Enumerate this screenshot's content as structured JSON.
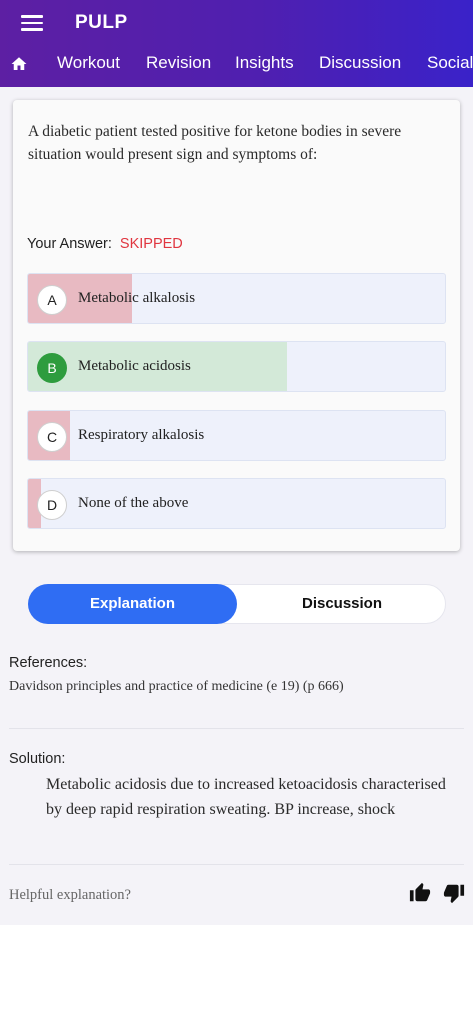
{
  "app": {
    "title": "PULP"
  },
  "nav": {
    "tabs": [
      "Workout",
      "Revision",
      "Insights",
      "Discussion",
      "Social"
    ]
  },
  "question": {
    "text": "A diabetic patient tested positive for ketone bodies in severe situation would present sign and symptoms of:",
    "your_answer_label": "Your Answer:",
    "your_answer_value": "SKIPPED"
  },
  "options": [
    {
      "letter": "A",
      "text": "Metabolic alkalosis",
      "response_share_pct": 25,
      "correct": false
    },
    {
      "letter": "B",
      "text": "Metabolic acidosis",
      "response_share_pct": 62,
      "correct": true
    },
    {
      "letter": "C",
      "text": "Respiratory alkalosis",
      "response_share_pct": 10,
      "correct": false
    },
    {
      "letter": "D",
      "text": "None of the above",
      "response_share_pct": 3,
      "correct": false
    }
  ],
  "tabs": {
    "explanation": "Explanation",
    "discussion": "Discussion"
  },
  "references": {
    "title": "References:",
    "text": "Davidson principles and practice of medicine (e 19) (p 666)"
  },
  "solution": {
    "title": "Solution:",
    "text": "Metabolic acidosis due to increased ketoacidosis characterised by deep rapid respiration sweating. BP increase, shock"
  },
  "feedback": {
    "prompt": "Helpful explanation?"
  },
  "colors": {
    "header_gradient": [
      "#5d1fa3",
      "#3a22c9"
    ],
    "correct_fill": "#d3e9d8",
    "wrong_fill": "#e8bac2",
    "correct_badge": "#2e9c3e",
    "skipped": "#e0353f",
    "active_tab": "#2f6df3"
  }
}
